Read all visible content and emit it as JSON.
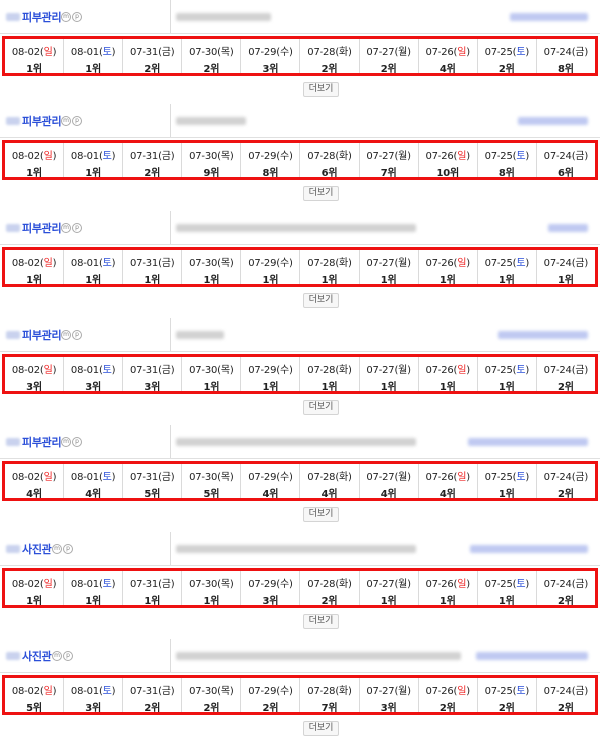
{
  "more_label": "더보기",
  "icons": [
    "m",
    "p"
  ],
  "colors": {
    "sunday": "#ee2222",
    "saturday": "#2b4fd8",
    "highlight": "#ee1111",
    "keyword": "#2b4fd8"
  },
  "days": [
    {
      "date": "08-02",
      "dow": "일",
      "type": "sun"
    },
    {
      "date": "08-01",
      "dow": "토",
      "type": "sat"
    },
    {
      "date": "07-31",
      "dow": "금",
      "type": "wk"
    },
    {
      "date": "07-30",
      "dow": "목",
      "type": "wk"
    },
    {
      "date": "07-29",
      "dow": "수",
      "type": "wk"
    },
    {
      "date": "07-28",
      "dow": "화",
      "type": "wk"
    },
    {
      "date": "07-27",
      "dow": "월",
      "type": "wk"
    },
    {
      "date": "07-26",
      "dow": "일",
      "type": "sun"
    },
    {
      "date": "07-25",
      "dow": "토",
      "type": "sat"
    },
    {
      "date": "07-24",
      "dow": "금",
      "type": "wk"
    }
  ],
  "blocks": [
    {
      "keyword": "피부관리",
      "ranks": [
        "1위",
        "1위",
        "2위",
        "2위",
        "3위",
        "2위",
        "2위",
        "4위",
        "2위",
        "8위"
      ]
    },
    {
      "keyword": "피부관리",
      "ranks": [
        "1위",
        "1위",
        "2위",
        "9위",
        "8위",
        "6위",
        "7위",
        "10위",
        "8위",
        "6위"
      ]
    },
    {
      "keyword": "피부관리",
      "ranks": [
        "1위",
        "1위",
        "1위",
        "1위",
        "1위",
        "1위",
        "1위",
        "1위",
        "1위",
        "1위"
      ]
    },
    {
      "keyword": "피부관리",
      "ranks": [
        "3위",
        "3위",
        "3위",
        "1위",
        "1위",
        "1위",
        "1위",
        "1위",
        "1위",
        "2위"
      ]
    },
    {
      "keyword": "피부관리",
      "ranks": [
        "4위",
        "4위",
        "5위",
        "5위",
        "4위",
        "4위",
        "4위",
        "4위",
        "1위",
        "2위"
      ]
    },
    {
      "keyword": "사진관",
      "ranks": [
        "1위",
        "1위",
        "1위",
        "1위",
        "3위",
        "2위",
        "1위",
        "1위",
        "1위",
        "2위"
      ]
    },
    {
      "keyword": "사진관",
      "ranks": [
        "5위",
        "3위",
        "2위",
        "2위",
        "2위",
        "7위",
        "3위",
        "2위",
        "2위",
        "2위"
      ]
    }
  ]
}
